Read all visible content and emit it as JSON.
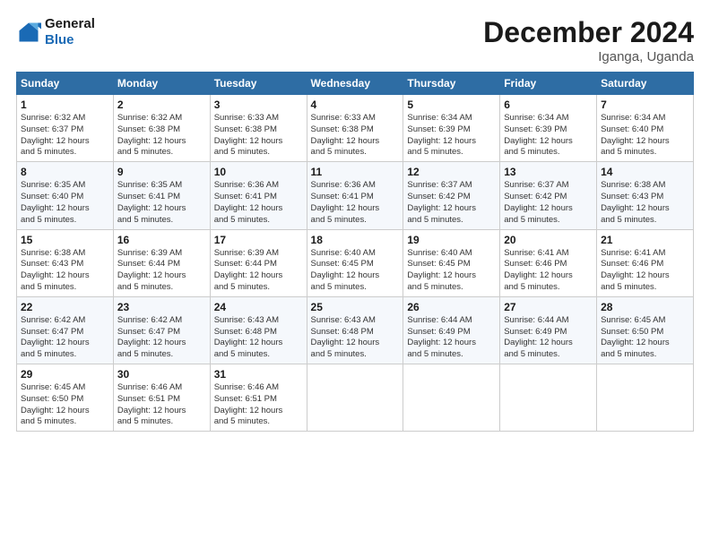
{
  "logo": {
    "line1": "General",
    "line2": "Blue"
  },
  "title": "December 2024",
  "subtitle": "Iganga, Uganda",
  "days_header": [
    "Sunday",
    "Monday",
    "Tuesday",
    "Wednesday",
    "Thursday",
    "Friday",
    "Saturday"
  ],
  "weeks": [
    [
      {
        "day": "1",
        "info": "Sunrise: 6:32 AM\nSunset: 6:37 PM\nDaylight: 12 hours\nand 5 minutes."
      },
      {
        "day": "2",
        "info": "Sunrise: 6:32 AM\nSunset: 6:38 PM\nDaylight: 12 hours\nand 5 minutes."
      },
      {
        "day": "3",
        "info": "Sunrise: 6:33 AM\nSunset: 6:38 PM\nDaylight: 12 hours\nand 5 minutes."
      },
      {
        "day": "4",
        "info": "Sunrise: 6:33 AM\nSunset: 6:38 PM\nDaylight: 12 hours\nand 5 minutes."
      },
      {
        "day": "5",
        "info": "Sunrise: 6:34 AM\nSunset: 6:39 PM\nDaylight: 12 hours\nand 5 minutes."
      },
      {
        "day": "6",
        "info": "Sunrise: 6:34 AM\nSunset: 6:39 PM\nDaylight: 12 hours\nand 5 minutes."
      },
      {
        "day": "7",
        "info": "Sunrise: 6:34 AM\nSunset: 6:40 PM\nDaylight: 12 hours\nand 5 minutes."
      }
    ],
    [
      {
        "day": "8",
        "info": "Sunrise: 6:35 AM\nSunset: 6:40 PM\nDaylight: 12 hours\nand 5 minutes."
      },
      {
        "day": "9",
        "info": "Sunrise: 6:35 AM\nSunset: 6:41 PM\nDaylight: 12 hours\nand 5 minutes."
      },
      {
        "day": "10",
        "info": "Sunrise: 6:36 AM\nSunset: 6:41 PM\nDaylight: 12 hours\nand 5 minutes."
      },
      {
        "day": "11",
        "info": "Sunrise: 6:36 AM\nSunset: 6:41 PM\nDaylight: 12 hours\nand 5 minutes."
      },
      {
        "day": "12",
        "info": "Sunrise: 6:37 AM\nSunset: 6:42 PM\nDaylight: 12 hours\nand 5 minutes."
      },
      {
        "day": "13",
        "info": "Sunrise: 6:37 AM\nSunset: 6:42 PM\nDaylight: 12 hours\nand 5 minutes."
      },
      {
        "day": "14",
        "info": "Sunrise: 6:38 AM\nSunset: 6:43 PM\nDaylight: 12 hours\nand 5 minutes."
      }
    ],
    [
      {
        "day": "15",
        "info": "Sunrise: 6:38 AM\nSunset: 6:43 PM\nDaylight: 12 hours\nand 5 minutes."
      },
      {
        "day": "16",
        "info": "Sunrise: 6:39 AM\nSunset: 6:44 PM\nDaylight: 12 hours\nand 5 minutes."
      },
      {
        "day": "17",
        "info": "Sunrise: 6:39 AM\nSunset: 6:44 PM\nDaylight: 12 hours\nand 5 minutes."
      },
      {
        "day": "18",
        "info": "Sunrise: 6:40 AM\nSunset: 6:45 PM\nDaylight: 12 hours\nand 5 minutes."
      },
      {
        "day": "19",
        "info": "Sunrise: 6:40 AM\nSunset: 6:45 PM\nDaylight: 12 hours\nand 5 minutes."
      },
      {
        "day": "20",
        "info": "Sunrise: 6:41 AM\nSunset: 6:46 PM\nDaylight: 12 hours\nand 5 minutes."
      },
      {
        "day": "21",
        "info": "Sunrise: 6:41 AM\nSunset: 6:46 PM\nDaylight: 12 hours\nand 5 minutes."
      }
    ],
    [
      {
        "day": "22",
        "info": "Sunrise: 6:42 AM\nSunset: 6:47 PM\nDaylight: 12 hours\nand 5 minutes."
      },
      {
        "day": "23",
        "info": "Sunrise: 6:42 AM\nSunset: 6:47 PM\nDaylight: 12 hours\nand 5 minutes."
      },
      {
        "day": "24",
        "info": "Sunrise: 6:43 AM\nSunset: 6:48 PM\nDaylight: 12 hours\nand 5 minutes."
      },
      {
        "day": "25",
        "info": "Sunrise: 6:43 AM\nSunset: 6:48 PM\nDaylight: 12 hours\nand 5 minutes."
      },
      {
        "day": "26",
        "info": "Sunrise: 6:44 AM\nSunset: 6:49 PM\nDaylight: 12 hours\nand 5 minutes."
      },
      {
        "day": "27",
        "info": "Sunrise: 6:44 AM\nSunset: 6:49 PM\nDaylight: 12 hours\nand 5 minutes."
      },
      {
        "day": "28",
        "info": "Sunrise: 6:45 AM\nSunset: 6:50 PM\nDaylight: 12 hours\nand 5 minutes."
      }
    ],
    [
      {
        "day": "29",
        "info": "Sunrise: 6:45 AM\nSunset: 6:50 PM\nDaylight: 12 hours\nand 5 minutes."
      },
      {
        "day": "30",
        "info": "Sunrise: 6:46 AM\nSunset: 6:51 PM\nDaylight: 12 hours\nand 5 minutes."
      },
      {
        "day": "31",
        "info": "Sunrise: 6:46 AM\nSunset: 6:51 PM\nDaylight: 12 hours\nand 5 minutes."
      },
      {
        "day": "",
        "info": ""
      },
      {
        "day": "",
        "info": ""
      },
      {
        "day": "",
        "info": ""
      },
      {
        "day": "",
        "info": ""
      }
    ]
  ]
}
